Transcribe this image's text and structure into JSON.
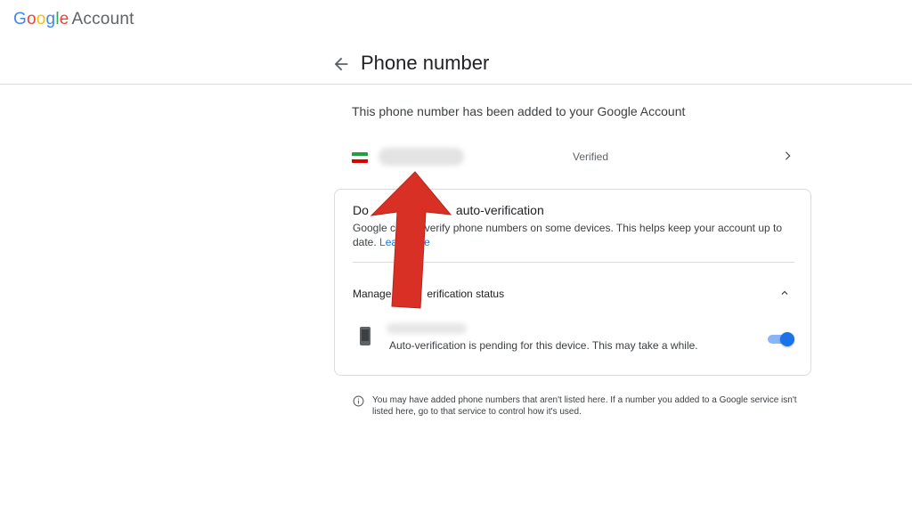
{
  "header": {
    "logo_letters": [
      "G",
      "o",
      "o",
      "g",
      "l",
      "e"
    ],
    "logo_colors": [
      "#4285F4",
      "#EA4335",
      "#FBBC05",
      "#4285F4",
      "#34A853",
      "#EA4335"
    ],
    "logo_suffix": "Account"
  },
  "page": {
    "title": "Phone number",
    "back_icon": "arrow-left-icon"
  },
  "intro_text": "This phone number has been added to your Google Account",
  "phone_entry": {
    "country_flag": "iran-flag-icon",
    "status": "Verified",
    "chevron_icon": "chevron-right-icon"
  },
  "auto_verification": {
    "title_visible": "Do",
    "title_visible_end": "auto-verification",
    "description_start": "Google ca",
    "description_rest": "-verify phone numbers on some devices. This helps keep your account up to date.",
    "learn_more": "Lea",
    "learn_more_end": "e",
    "manage_title_start": "Manage",
    "manage_title_end": "erification status",
    "device_status": "Auto-verification is pending for this device. This may take a while.",
    "toggle_on": true
  },
  "footer_note": "You may have added phone numbers that aren't listed here. If a number you added to a Google service isn't listed here, go to that service to control how it's used.",
  "colors": {
    "accent": "#1a73e8",
    "annotation_arrow": "#d93025",
    "flag_green": "#239f40",
    "flag_white": "#ffffff",
    "flag_red": "#da0000"
  }
}
